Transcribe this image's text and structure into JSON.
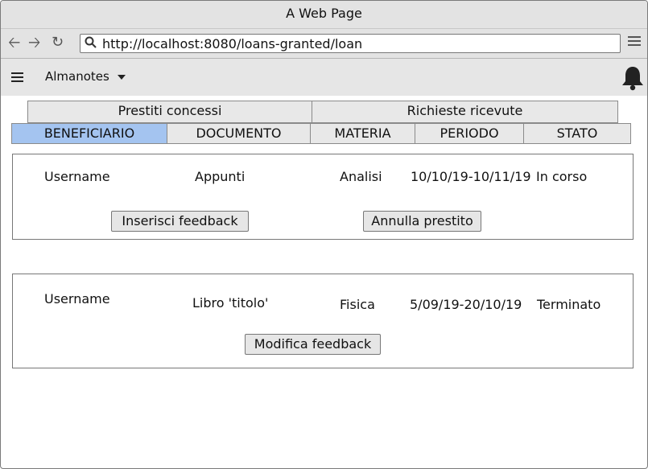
{
  "window": {
    "title": "A Web Page"
  },
  "browser": {
    "url": "http://localhost:8080/loans-granted/loan"
  },
  "app": {
    "brand": "Almanotes"
  },
  "tabs": [
    {
      "label": "Prestiti concessi",
      "active": true
    },
    {
      "label": "Richieste ricevute",
      "active": false
    }
  ],
  "filters": [
    {
      "label": "BENEFICIARIO",
      "active": true
    },
    {
      "label": "DOCUMENTO",
      "active": false
    },
    {
      "label": "MATERIA",
      "active": false
    },
    {
      "label": "PERIODO",
      "active": false
    },
    {
      "label": "STATO",
      "active": false
    }
  ],
  "loans": [
    {
      "user": "Username",
      "document": "Appunti",
      "subject": "Analisi",
      "period": "10/10/19-10/11/19",
      "status": "In corso",
      "actions": [
        "Inserisci feedback",
        "Annulla prestito"
      ]
    },
    {
      "user": "Username",
      "document": "Libro 'titolo'",
      "subject": "Fisica",
      "period": "5/09/19-20/10/19",
      "status": "Terminato",
      "actions": [
        "Modifica feedback"
      ]
    }
  ],
  "colors": {
    "active_filter": "#a4c4f0",
    "chrome": "#e3e3e3"
  },
  "icons": [
    "back-arrow-icon",
    "forward-arrow-icon",
    "reload-icon",
    "search-icon",
    "menu-icon",
    "hamburger-icon",
    "caret-down-icon",
    "bell-icon"
  ]
}
